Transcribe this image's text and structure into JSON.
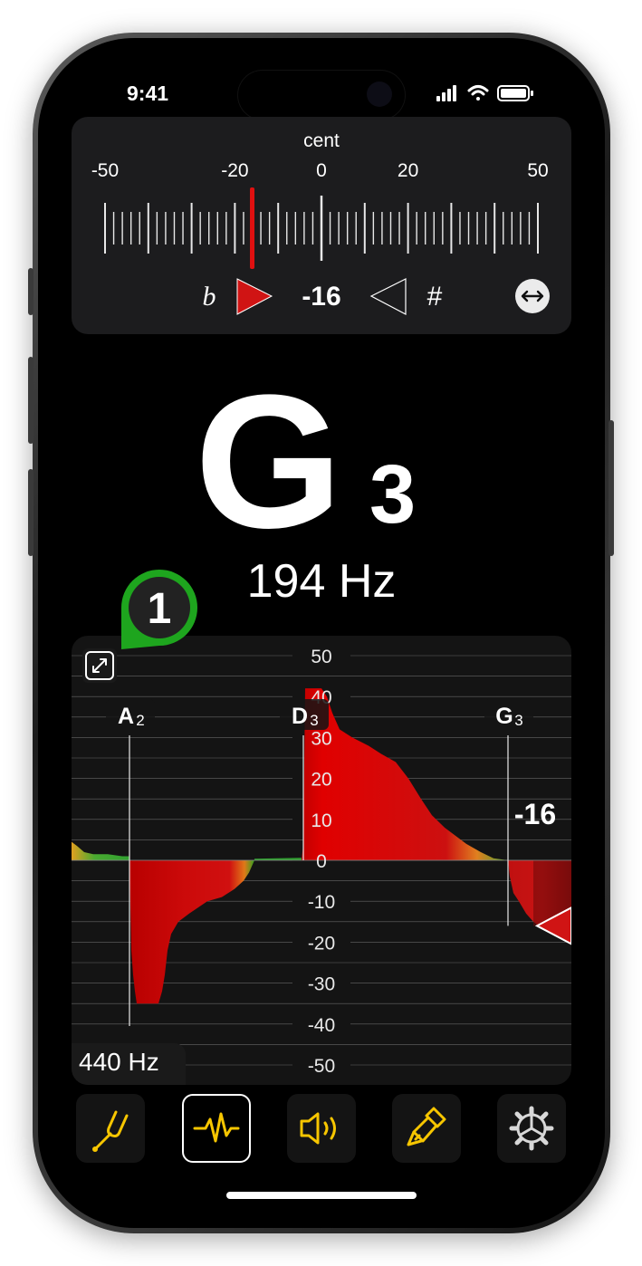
{
  "status": {
    "time": "9:41"
  },
  "cent_meter": {
    "label": "cent",
    "scale": [
      "-50",
      "-20",
      "0",
      "20",
      "50"
    ],
    "flat_symbol": "b",
    "sharp_symbol": "#",
    "deviation": "-16",
    "swap_icon": "left-right-arrow-icon"
  },
  "note": {
    "name": "G",
    "octave": "3",
    "frequency": "194 Hz"
  },
  "badge": {
    "number": "1"
  },
  "history": {
    "y_ticks": [
      "50",
      "40",
      "30",
      "20",
      "10",
      "0",
      "-10",
      "-20",
      "-30",
      "-40",
      "-50"
    ],
    "notes": [
      {
        "name": "A",
        "octave": "2"
      },
      {
        "name": "D",
        "octave": "3"
      },
      {
        "name": "G",
        "octave": "3"
      }
    ],
    "current_value": "-16",
    "reference": "440 Hz",
    "expand_icon": "expand-icon"
  },
  "tabs": [
    {
      "name": "tuning-fork-icon",
      "active": false
    },
    {
      "name": "waveform-icon",
      "active": true
    },
    {
      "name": "speaker-icon",
      "active": false
    },
    {
      "name": "brush-icon",
      "active": false
    },
    {
      "name": "gear-icon",
      "active": false
    }
  ],
  "colors": {
    "accent": "#f7c600",
    "flat_red": "#cc1111",
    "in_tune_green": "#22aa22",
    "badge_green": "#1ea51e"
  }
}
